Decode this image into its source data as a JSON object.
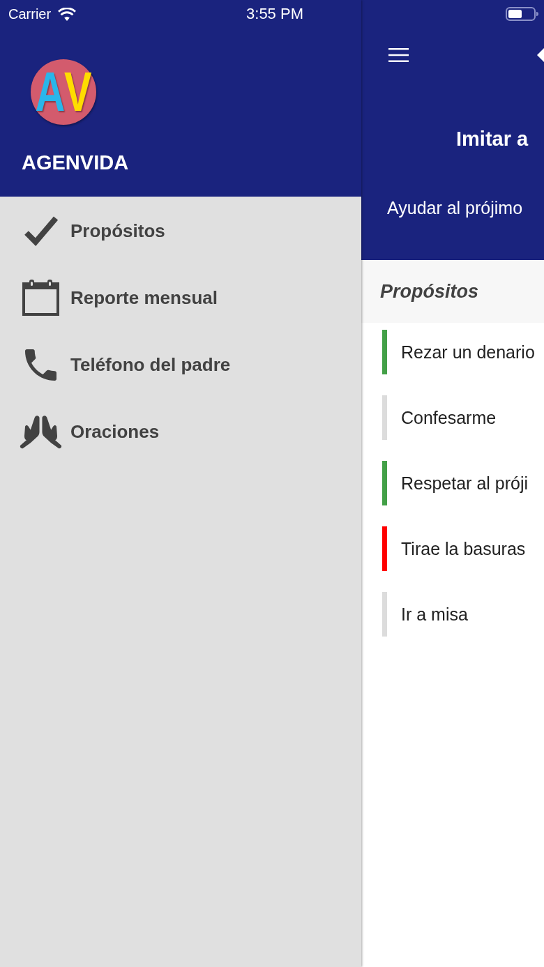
{
  "status_bar": {
    "carrier": "Carrier",
    "time": "3:55 PM"
  },
  "drawer": {
    "logo": {
      "letters": [
        {
          "text": "A",
          "color": "#29b6ea"
        },
        {
          "text": "V",
          "color": "#ffdd00"
        }
      ]
    },
    "app_name": "AGENVIDA",
    "items": [
      {
        "label": "Propósitos"
      },
      {
        "label": "Reporte mensual"
      },
      {
        "label": "Teléfono del padre"
      },
      {
        "label": "Oraciones"
      }
    ]
  },
  "main": {
    "title": "Imitar a",
    "subtitle": "Ayudar al prójimo",
    "section_title": "Propósitos",
    "items": [
      {
        "label": "Rezar un denario",
        "color": "#43a047"
      },
      {
        "label": "Confesarme",
        "color": "#dcdcdc"
      },
      {
        "label": "Respetar al próji",
        "color": "#43a047"
      },
      {
        "label": "Tirae la basuras",
        "color": "#ff0000"
      },
      {
        "label": "Ir a misa",
        "color": "#dcdcdc"
      }
    ]
  }
}
